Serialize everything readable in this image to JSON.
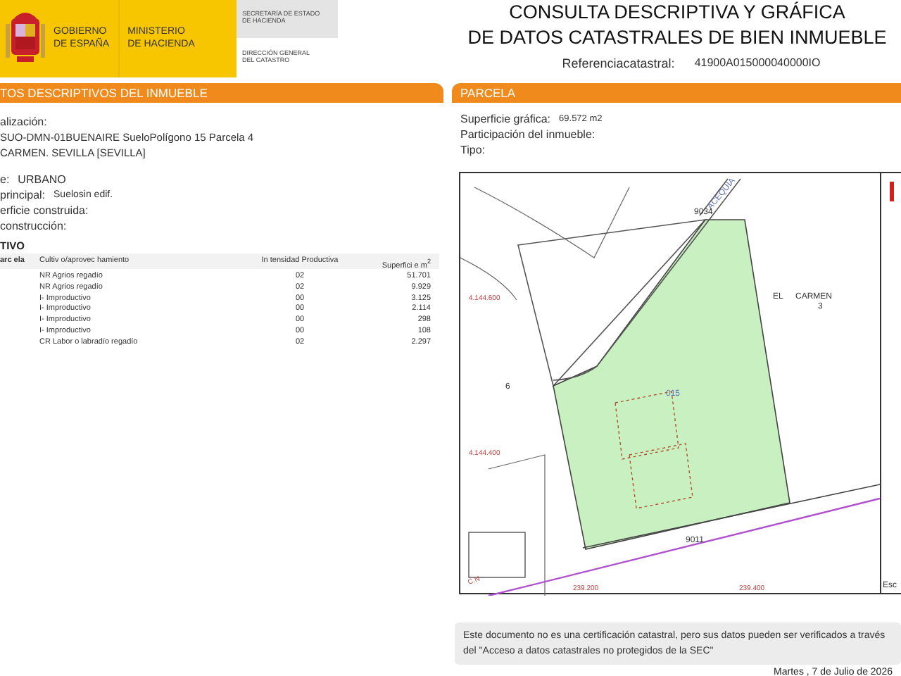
{
  "header": {
    "gov_name": "GOBIERNO\nDE ESPAÑA",
    "ministry": "MINISTERIO\nDE HACIENDA",
    "secretaria": "SECRETARÍA DE ESTADO\nDE HACIENDA",
    "direccion": "DIRECCIÓN GENERAL\nDEL CATASTRO"
  },
  "title": {
    "line_1": "CONSULTA DESCRIPTIVA Y GRÁFICA",
    "line_2": "DE DATOS CATASTRALES DE BIEN INMUEBLE",
    "ref_label": "Referenciacatastral:",
    "ref_value": "41900A015000040000IO"
  },
  "datos": {
    "heading": "TOS DESCRIPTIVOS DEL INMUEBLE",
    "fields": [
      {
        "label": "alización:",
        "kind": "field"
      },
      {
        "label": "SUO-DMN-01BUENAIRE SueloPolígono 15 Parcela 4",
        "kind": "plain"
      },
      {
        "label": "CARMEN. SEVILLA [SEVILLA]",
        "kind": "plain"
      },
      {
        "label": "e:",
        "value": "URBANO",
        "kind": "gap"
      },
      {
        "label": "principal:",
        "value": "Suelosin edif.",
        "kind": "field"
      },
      {
        "label": "erficie construida:",
        "kind": "field"
      },
      {
        "label": "construcción:",
        "kind": "field"
      }
    ],
    "cultivo_heading": "TIVO",
    "columns": [
      "arc ela",
      "Cultiv o/aprovec hamiento",
      "In tensidad Productiva",
      "Superfici e m$^{2}$"
    ],
    "rows": [
      [
        "",
        "NR Agrios regadío",
        "02",
        "51.701"
      ],
      [
        "",
        "NR Agrios regadío",
        "02",
        "9.929"
      ],
      [
        "",
        "I- Improductivo",
        "00",
        "3.125"
      ],
      [
        "",
        "I- Improductivo",
        "00",
        "2.114"
      ],
      [
        "",
        "I- Improductivo",
        "00",
        "298"
      ],
      [
        "",
        "I- Improductivo",
        "00",
        "108"
      ],
      [
        "",
        "CR Labor o labradío regadío",
        "02",
        "2.297"
      ]
    ]
  },
  "parcela": {
    "heading": "PARCELA",
    "fields": [
      {
        "label": "Superficie gráfica:",
        "value": "69.572 m2"
      },
      {
        "label": "Participación del inmueble:"
      },
      {
        "label": "Tipo:"
      }
    ]
  },
  "map": {
    "labels": [
      "ACEQUIA",
      "9034",
      "4.144.600",
      "EL",
      "CARMEN",
      "3",
      "6",
      "015",
      "4.144.400",
      "9011",
      "C.N",
      "239.200",
      "239.400"
    ],
    "scale_label": "Esc"
  },
  "note": "Este documento no es una certificación catastral, pero sus datos pueden ser verificados a través del \"Acceso a datos catastrales no protegidos de la SEC\"",
  "date": "Martes , 7 de Julio de 2026"
}
